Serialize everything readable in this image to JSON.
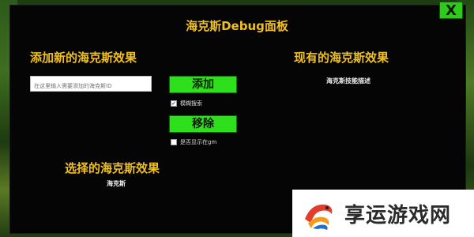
{
  "panel": {
    "title": "海克斯Debug面板",
    "close_label": "X"
  },
  "add_section": {
    "heading": "添加新的海克斯效果",
    "input_placeholder": "在这里输入需要添加的海克斯ID",
    "input_value": "",
    "add_button": "添加",
    "fuzzy_search_label": "模糊搜索",
    "fuzzy_search_checked": true,
    "remove_button": "移除",
    "show_in_gm_label": "是否显示在gm",
    "show_in_gm_checked": false
  },
  "existing_section": {
    "heading": "现有的海克斯效果",
    "description": "海克斯技能描述"
  },
  "selected_section": {
    "heading": "选择的海克斯效果",
    "value": "海克斯"
  },
  "watermark": {
    "text": "享运游戏网"
  },
  "colors": {
    "accent_yellow": "#f0c020",
    "button_green": "#2ee01c",
    "panel_bg": "#050505"
  }
}
